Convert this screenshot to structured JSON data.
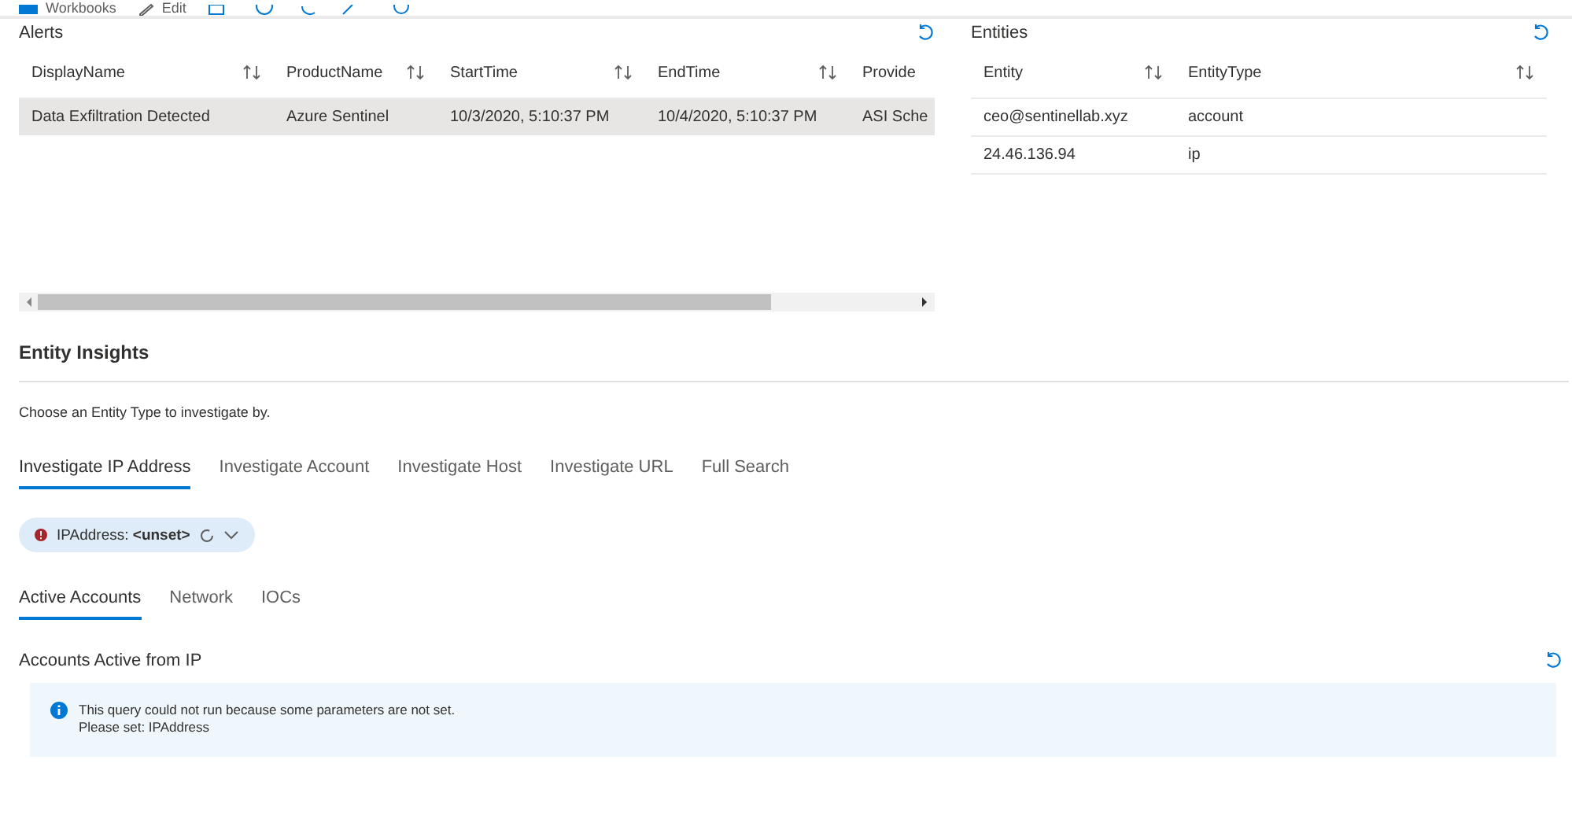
{
  "toolbar": {
    "items": [
      {
        "kind": "workbooks",
        "label": "Workbooks"
      },
      {
        "kind": "edit",
        "label": "Edit"
      }
    ]
  },
  "alerts": {
    "title": "Alerts",
    "columns": [
      {
        "label": "DisplayName",
        "sortable": true
      },
      {
        "label": "ProductName",
        "sortable": true
      },
      {
        "label": "StartTime",
        "sortable": true
      },
      {
        "label": "EndTime",
        "sortable": true
      },
      {
        "label": "Provide",
        "sortable": false
      }
    ],
    "rows": [
      {
        "cells": [
          "Data Exfiltration Detected",
          "Azure Sentinel",
          "10/3/2020, 5:10:37 PM",
          "10/4/2020, 5:10:37 PM",
          "ASI Sche"
        ],
        "selected": true
      }
    ]
  },
  "entities": {
    "title": "Entities",
    "columns": [
      {
        "label": "Entity",
        "sortable": true
      },
      {
        "label": "EntityType",
        "sortable": true
      }
    ],
    "rows": [
      {
        "cells": [
          "ceo@sentinellab.xyz",
          "account"
        ],
        "selected": false
      },
      {
        "cells": [
          "24.46.136.94",
          "ip"
        ],
        "selected": false
      }
    ]
  },
  "insights": {
    "title": "Entity Insights",
    "description": "Choose an Entity Type to investigate by.",
    "tabs": [
      {
        "label": "Investigate IP Address",
        "selected": true
      },
      {
        "label": "Investigate Account",
        "selected": false
      },
      {
        "label": "Investigate Host",
        "selected": false
      },
      {
        "label": "Investigate URL",
        "selected": false
      },
      {
        "label": "Full Search",
        "selected": false
      }
    ],
    "parameter": {
      "text": "IPAddress: **<unset>**",
      "error": true
    },
    "subtabs": [
      {
        "label": "Active Accounts",
        "selected": true
      },
      {
        "label": "Network",
        "selected": false
      },
      {
        "label": "IOCs",
        "selected": false
      }
    ],
    "query_title": "Accounts Active from IP",
    "message": [
      "This query could not run because some parameters are not set.",
      "Please set: IPAddress"
    ]
  }
}
